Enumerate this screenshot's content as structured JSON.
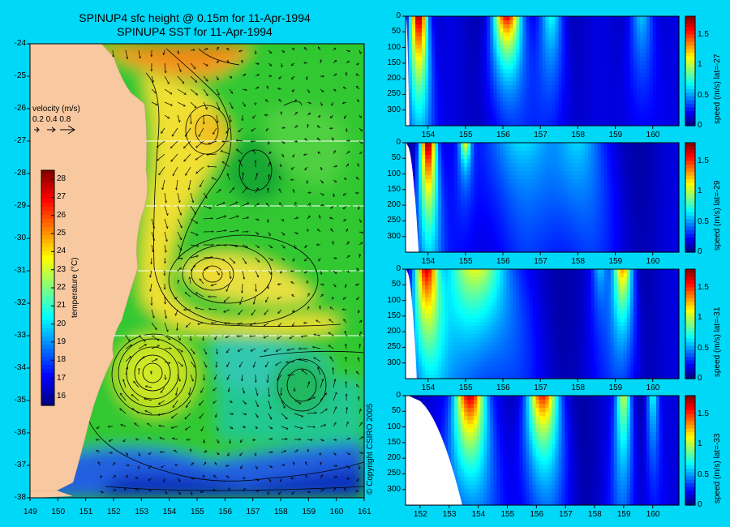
{
  "titles": {
    "line1": "SPINUP4 sfc height @ 0.15m for 11-Apr-1994",
    "line2": "SPINUP4 SST for 11-Apr-1994"
  },
  "copyright": "© Copyright CSIRO 2005",
  "colors": {
    "background": "#00d8f8",
    "land": "#f8c8a0",
    "colormap": [
      "#00007f",
      "#0000ff",
      "#007fff",
      "#00ffff",
      "#7fff7f",
      "#ffff00",
      "#ff7f00",
      "#ff0000",
      "#7f0000"
    ]
  },
  "chart_data": [
    {
      "type": "heatmap",
      "title": "SPINUP4 SST for 11-Apr-1994",
      "subtitle": "SPINUP4 sfc height @ 0.15m for 11-Apr-1994",
      "x_ticks": [
        "149",
        "150",
        "151",
        "152",
        "153",
        "154",
        "155",
        "156",
        "157",
        "158",
        "159",
        "160",
        "161"
      ],
      "y_ticks": [
        "-24",
        "-25",
        "-26",
        "-27",
        "-28",
        "-29",
        "-30",
        "-31",
        "-32",
        "-33",
        "-34",
        "-35",
        "-36",
        "-37",
        "-38"
      ],
      "xlim": [
        149,
        161
      ],
      "ylim": [
        -38,
        -24
      ],
      "section_latitudes": [
        -27,
        -29,
        -31,
        -33
      ],
      "colorbar": {
        "label": "temperature (°C)",
        "ticks": [
          "16",
          "17",
          "18",
          "19",
          "20",
          "21",
          "22",
          "23",
          "24",
          "25",
          "26",
          "27",
          "28"
        ],
        "range": [
          15.5,
          28.5
        ]
      },
      "velocity_legend": {
        "title": "velocity (m/s)",
        "values": [
          "0.2",
          "0.4",
          "0.8"
        ]
      },
      "eddies": [
        {
          "lon": 153.6,
          "lat": -34.3,
          "type": "warm-core"
        },
        {
          "lon": 155.6,
          "lat": -31.2,
          "type": "warm"
        },
        {
          "lon": 154.5,
          "lat": -26.5,
          "type": "warm"
        },
        {
          "lon": 155.3,
          "lat": -28.2,
          "type": "cool"
        },
        {
          "lon": 158.7,
          "lat": -34.5,
          "type": "cool"
        }
      ]
    },
    {
      "type": "heatmap",
      "xlim": [
        153.4,
        160.7
      ],
      "x_ticks": [
        "154",
        "155",
        "156",
        "157",
        "158",
        "159",
        "160"
      ],
      "y_ticks": [
        "0",
        "50",
        "100",
        "150",
        "200",
        "250",
        "300"
      ],
      "ylim": [
        0,
        350
      ],
      "colorbar": {
        "label": "speed (m/s) lat=-27",
        "ticks": [
          "0",
          "0.5",
          "1",
          "1.5"
        ],
        "range": [
          0,
          1.8
        ]
      },
      "jets": [
        {
          "lon": 153.75,
          "peak": 1.7,
          "width": 0.22,
          "depth": 340
        },
        {
          "lon": 156.1,
          "peak": 1.5,
          "width": 0.35,
          "depth": 200
        },
        {
          "lon": 157.3,
          "peak": 0.6,
          "width": 0.3,
          "depth": 350
        },
        {
          "lon": 159.7,
          "peak": 0.5,
          "width": 0.3,
          "depth": 350
        }
      ]
    },
    {
      "type": "heatmap",
      "xlim": [
        153.4,
        160.7
      ],
      "x_ticks": [
        "154",
        "155",
        "156",
        "157",
        "158",
        "159",
        "160"
      ],
      "y_ticks": [
        "0",
        "50",
        "100",
        "150",
        "200",
        "250",
        "300"
      ],
      "ylim": [
        0,
        350
      ],
      "colorbar": {
        "label": "speed (m/s) lat=-29",
        "ticks": [
          "0",
          "0.5",
          "1",
          "1.5"
        ],
        "range": [
          0,
          1.8
        ]
      },
      "jets": [
        {
          "lon": 154.0,
          "peak": 1.7,
          "width": 0.2,
          "depth": 320
        },
        {
          "lon": 155.0,
          "peak": 0.9,
          "width": 0.15,
          "depth": 100
        },
        {
          "lon": 156.5,
          "peak": 0.45,
          "width": 1.2,
          "depth": 350
        },
        {
          "lon": 158.0,
          "peak": 0.4,
          "width": 0.6,
          "depth": 350
        }
      ]
    },
    {
      "type": "heatmap",
      "xlim": [
        153.4,
        160.7
      ],
      "x_ticks": [
        "154",
        "155",
        "156",
        "157",
        "158",
        "159",
        "160"
      ],
      "y_ticks": [
        "0",
        "50",
        "100",
        "150",
        "200",
        "250",
        "300"
      ],
      "ylim": [
        0,
        350
      ],
      "colorbar": {
        "label": "speed (m/s) lat=-31",
        "ticks": [
          "0",
          "0.5",
          "1",
          "1.5"
        ],
        "range": [
          0,
          1.8
        ]
      },
      "jets": [
        {
          "lon": 153.95,
          "peak": 1.5,
          "width": 0.3,
          "depth": 300
        },
        {
          "lon": 155.3,
          "peak": 1.0,
          "width": 0.8,
          "depth": 350
        },
        {
          "lon": 159.2,
          "peak": 1.2,
          "width": 0.25,
          "depth": 260
        },
        {
          "lon": 158.6,
          "peak": 0.4,
          "width": 0.2,
          "depth": 200
        }
      ]
    },
    {
      "type": "heatmap",
      "xlim": [
        151.5,
        160.9
      ],
      "x_ticks": [
        "152",
        "153",
        "154",
        "155",
        "156",
        "157",
        "158",
        "159",
        "160"
      ],
      "y_ticks": [
        "0",
        "50",
        "100",
        "150",
        "200",
        "250",
        "300"
      ],
      "ylim": [
        0,
        350
      ],
      "colorbar": {
        "label": "speed (m/s) lat=-33",
        "ticks": [
          "0",
          "0.5",
          "1",
          "1.5"
        ],
        "range": [
          0,
          1.8
        ]
      },
      "jets": [
        {
          "lon": 153.7,
          "peak": 1.6,
          "width": 0.5,
          "depth": 300
        },
        {
          "lon": 156.2,
          "peak": 1.4,
          "width": 0.5,
          "depth": 260
        },
        {
          "lon": 159.0,
          "peak": 0.9,
          "width": 0.25,
          "depth": 350
        },
        {
          "lon": 160.0,
          "peak": 0.6,
          "width": 0.2,
          "depth": 300
        }
      ]
    }
  ]
}
